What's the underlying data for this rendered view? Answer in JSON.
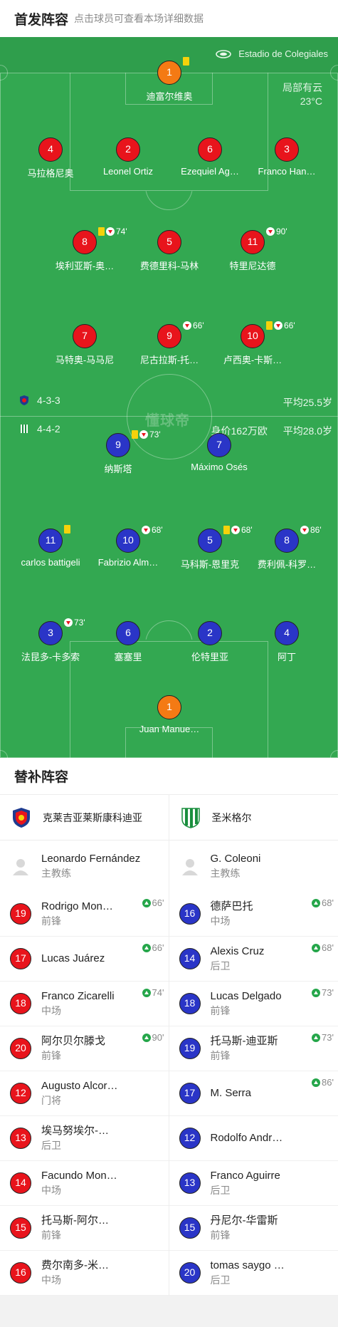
{
  "lineup": {
    "title": "首发阵容",
    "subtitle": "点击球员可查看本场详细数据",
    "stadium": "Estadio de Colegiales",
    "weather": "局部有云",
    "temperature": "23°C",
    "watermark": "懂球帝",
    "home": {
      "formation": "4-3-3",
      "avg_age": "平均25.5岁"
    },
    "away": {
      "formation": "4-4-2",
      "market_value": "身价162万欧",
      "avg_age": "平均28.0岁"
    }
  },
  "home_players": [
    {
      "number": "1",
      "name": "迪富尔维奥",
      "ycard": true,
      "sub": "",
      "color": "#f47a14"
    },
    {
      "number": "4",
      "name": "马拉格尼奥",
      "ycard": false,
      "sub": ""
    },
    {
      "number": "2",
      "name": "Leonel Ortiz",
      "ycard": false,
      "sub": ""
    },
    {
      "number": "6",
      "name": "Ezequiel Ag…",
      "ycard": false,
      "sub": ""
    },
    {
      "number": "3",
      "name": "Franco Han…",
      "ycard": false,
      "sub": ""
    },
    {
      "number": "8",
      "name": "埃利亚斯-奥…",
      "ycard": true,
      "sub": "74'"
    },
    {
      "number": "5",
      "name": "费德里科-马林",
      "ycard": false,
      "sub": ""
    },
    {
      "number": "11",
      "name": "特里尼达德",
      "ycard": false,
      "sub": "90'"
    },
    {
      "number": "7",
      "name": "马特奥-马马尼",
      "ycard": false,
      "sub": ""
    },
    {
      "number": "9",
      "name": "尼古拉斯-托…",
      "ycard": false,
      "sub": "66'"
    },
    {
      "number": "10",
      "name": "卢西奥-卡斯…",
      "ycard": true,
      "sub": "66'"
    }
  ],
  "away_players": [
    {
      "number": "9",
      "name": "纳斯塔",
      "ycard": true,
      "sub": "73'"
    },
    {
      "number": "7",
      "name": "Máximo Osés",
      "ycard": false,
      "sub": ""
    },
    {
      "number": "11",
      "name": "carlos battigeli",
      "ycard": true,
      "sub": ""
    },
    {
      "number": "10",
      "name": "Fabrizio Alm…",
      "ycard": false,
      "sub": "68'"
    },
    {
      "number": "5",
      "name": "马科斯-恩里克",
      "ycard": true,
      "sub": "68'"
    },
    {
      "number": "8",
      "name": "费利佩-科罗…",
      "ycard": false,
      "sub": "86'"
    },
    {
      "number": "3",
      "name": "法昆多-卡多索",
      "ycard": false,
      "sub": "73'"
    },
    {
      "number": "6",
      "name": "塞塞里",
      "ycard": false,
      "sub": ""
    },
    {
      "number": "2",
      "name": "伦特里亚",
      "ycard": false,
      "sub": ""
    },
    {
      "number": "4",
      "name": "阿丁",
      "ycard": false,
      "sub": ""
    },
    {
      "number": "1",
      "name": "Juan Manue…",
      "ycard": false,
      "sub": "",
      "color": "#f47a14"
    }
  ],
  "substitutes": {
    "title": "替补阵容",
    "home": {
      "team_name": "克莱吉亚莱斯康科迪亚",
      "coach_name": "Leonardo Fernández",
      "coach_label": "主教练",
      "players": [
        {
          "number": "19",
          "name": "Rodrigo Mon…",
          "position": "前锋",
          "in": "66'"
        },
        {
          "number": "17",
          "name": "Lucas Juárez",
          "position": "",
          "in": "66'"
        },
        {
          "number": "18",
          "name": "Franco Zicarelli",
          "position": "中场",
          "in": "74'"
        },
        {
          "number": "20",
          "name": "阿尔贝尔滕戈",
          "position": "前锋",
          "in": "90'"
        },
        {
          "number": "12",
          "name": "Augusto Alcor…",
          "position": "门将",
          "in": ""
        },
        {
          "number": "13",
          "name": "埃马努埃尔-…",
          "position": "后卫",
          "in": ""
        },
        {
          "number": "14",
          "name": "Facundo Mon…",
          "position": "中场",
          "in": ""
        },
        {
          "number": "15",
          "name": "托马斯-阿尔…",
          "position": "前锋",
          "in": ""
        },
        {
          "number": "16",
          "name": "费尔南多-米…",
          "position": "中场",
          "in": ""
        }
      ]
    },
    "away": {
      "team_name": "圣米格尔",
      "coach_name": "G. Coleoni",
      "coach_label": "主教练",
      "players": [
        {
          "number": "16",
          "name": "德萨巴托",
          "position": "中场",
          "in": "68'"
        },
        {
          "number": "14",
          "name": "Alexis Cruz",
          "position": "后卫",
          "in": "68'"
        },
        {
          "number": "18",
          "name": "Lucas Delgado",
          "position": "前锋",
          "in": "73'"
        },
        {
          "number": "19",
          "name": "托马斯-迪亚斯",
          "position": "前锋",
          "in": "73'"
        },
        {
          "number": "17",
          "name": "M. Serra",
          "position": "",
          "in": "86'"
        },
        {
          "number": "12",
          "name": "Rodolfo Andr…",
          "position": "",
          "in": ""
        },
        {
          "number": "13",
          "name": "Franco Aguirre",
          "position": "后卫",
          "in": ""
        },
        {
          "number": "15",
          "name": "丹尼尔-华雷斯",
          "position": "前锋",
          "in": ""
        },
        {
          "number": "20",
          "name": "tomas saygo …",
          "position": "后卫",
          "in": ""
        }
      ]
    }
  },
  "colors": {
    "home": "#e8141c",
    "away": "#2a35c7",
    "goalkeeper": "#f47a14",
    "pitch": "#33a851"
  }
}
